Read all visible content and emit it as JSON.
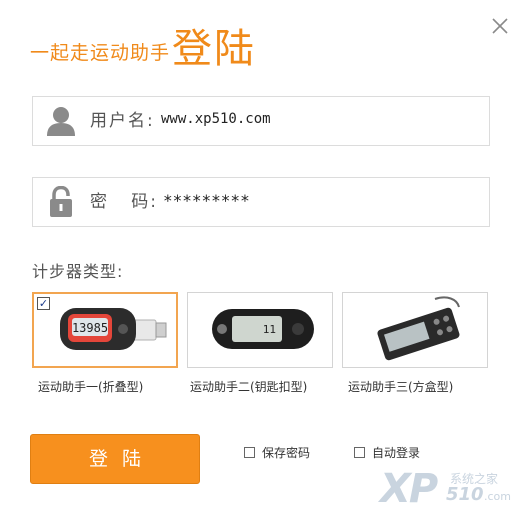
{
  "window": {
    "title_small": "一起走运动助手",
    "title_big": "登陆",
    "close_glyph": "X"
  },
  "form": {
    "username_label": "用户名:",
    "username_value": "www.xp510.com",
    "password_label": "密   码:",
    "password_value": "*********",
    "device_type_label": "计步器类型:"
  },
  "devices": [
    {
      "name": "运动助手一(折叠型)",
      "screen_text": "13985",
      "selected": true
    },
    {
      "name": "运动助手二(钥匙扣型)",
      "screen_text": "11",
      "selected": false
    },
    {
      "name": "运动助手三(方盒型)",
      "screen_text": "",
      "selected": false
    }
  ],
  "actions": {
    "login_label": "登陆",
    "remember_password_label": "保存密码",
    "auto_login_label": "自动登录",
    "check_mark": "✓"
  },
  "watermark": {
    "logo": "XP",
    "cn": "系统之家",
    "num": "510",
    "com": ".com"
  },
  "colors": {
    "accent": "#f08a1a",
    "button": "#f7901e",
    "selected_border": "#f2a550"
  }
}
